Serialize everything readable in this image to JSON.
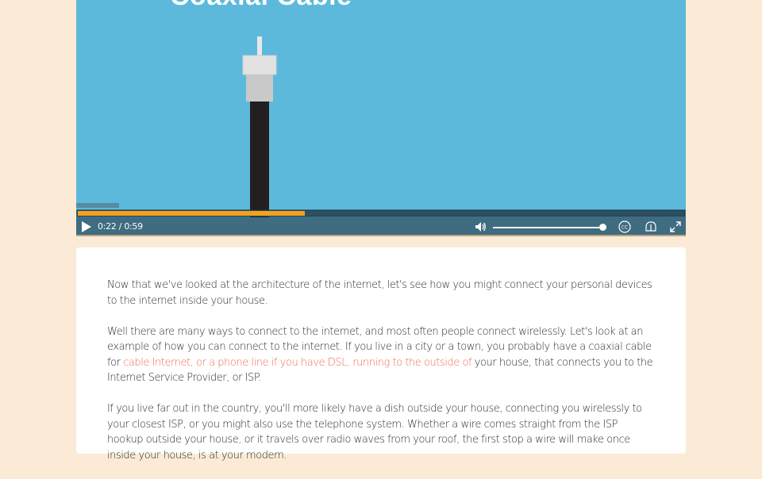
{
  "video": {
    "title": "Coaxial Cable",
    "progress_fraction": 0.374,
    "time_current": "0:22",
    "time_separator": "/",
    "time_total": "0:59",
    "volume_fraction": 0.97,
    "colors": {
      "background": "#5cb9dc",
      "progress": "#f5a01e",
      "controls": "#3f6c80"
    },
    "icons": [
      "play-icon",
      "volume-icon",
      "closed-captions-icon",
      "audio-description-icon",
      "fullscreen-icon"
    ]
  },
  "article": {
    "p1": "Now that we've looked at the architecture of the internet, let's see how you might connect your personal devices to the internet inside your house.",
    "p2_before": "Well there are many ways to connect to the internet, and most often people connect wirelessly. Let's look at an example of how you can connect to the internet. If you live in a city or a town, you probably have a coaxial cable for ",
    "p2_link": "cable Internet, or a phone line if you have DSL, running to the outside of",
    "p2_after": " your house, that connects you to the Internet Service Provider, or ISP.",
    "p3": "If you live far out in the country, you'll more likely have a dish outside your house, connecting you wirelessly to your closest ISP, or you might also use the telephone system. Whether a wire comes straight from the ISP hookup outside your house, or it travels over radio waves from your roof, the first stop a wire will make once inside your house, is at your modem."
  }
}
